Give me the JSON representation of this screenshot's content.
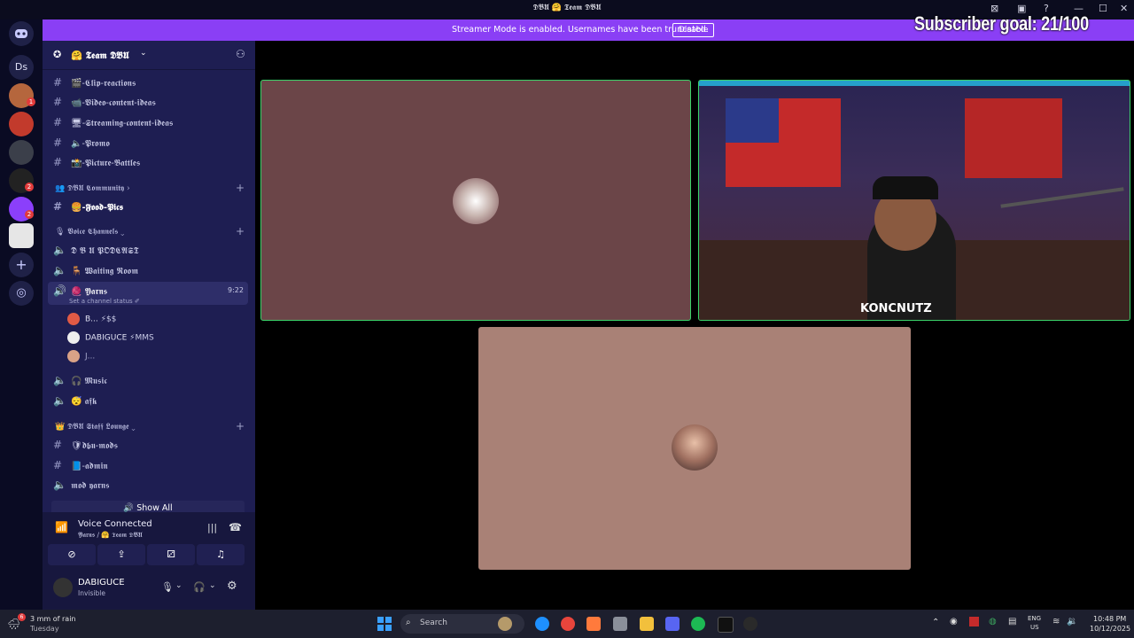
{
  "window": {
    "title": "𝕯𝕭𝖀 🤗 𝕿𝖊𝖆𝖒 𝕯𝕭𝖀",
    "controls": [
      "—",
      "☐",
      "✕"
    ]
  },
  "banner": {
    "message": "Streamer Mode is enabled. Usernames have been truncated.",
    "button": "Disable",
    "color": "#8a3ff5"
  },
  "overlay": {
    "subscriber_goal": "Subscriber goal: 21/100"
  },
  "rail": {
    "ds_label": "Ds",
    "badges": [
      "1",
      "2",
      "2",
      "5"
    ]
  },
  "guild": {
    "name": "🤗 𝕿𝖊𝖆𝖒 𝕯𝕭𝖀"
  },
  "channels": {
    "text_top": [
      {
        "label": "-𝕮𝖑𝖎𝖕-𝖗𝖊𝖆𝖈𝖙𝖎𝖔𝖓𝖘",
        "emoji": "🎬"
      },
      {
        "label": "-𝖁𝖎𝖉𝖊𝖔-𝖈𝖔𝖓𝖙𝖊𝖓𝖙-𝖎𝖉𝖊𝖆𝖘",
        "emoji": "📹"
      },
      {
        "label": "-𝕾𝖙𝖗𝖊𝖆𝖒𝖎𝖓𝖌-𝖈𝖔𝖓𝖙𝖊𝖓𝖙-𝖎𝖉𝖊𝖆𝖘",
        "emoji": "🖥"
      },
      {
        "label": "-𝕻𝖗𝖔𝖒𝖔",
        "emoji": "🔈"
      },
      {
        "label": "-𝕻𝖎𝖈𝖙𝖚𝖗𝖊-𝕭𝖆𝖙𝖙𝖑𝖊𝖘",
        "emoji": "📸"
      }
    ],
    "community_category": "𝕯𝕭𝖀 𝕮𝖔𝖒𝖒𝖚𝖓𝖎𝖙𝖞",
    "food_pics": "-𝕱𝖔𝖔𝖉-𝕻𝖎𝖈𝖘",
    "voice_category": "𝖁𝖔𝖎𝖈𝖊 𝕮𝖍𝖆𝖓𝖓𝖊𝖑𝖘",
    "voice_first": "𝕯 𝕭 𝖀 𝕻𝕺𝕯𝕮𝕬𝕾𝕿",
    "waiting_room": "𝖂𝖆𝖎𝖙𝖎𝖓𝖌 𝕽𝖔𝖔𝖒",
    "active": {
      "label": "𝖄𝖆𝖗𝖓𝖘",
      "time": "9:22",
      "status_hint": "Set a channel status ✐"
    },
    "members": [
      {
        "name": "B...",
        "tag": "⚡$$"
      },
      {
        "name": "DABIGUCE",
        "tag": "⚡MMS"
      },
      {
        "name": "J...",
        "tag": ""
      }
    ],
    "music": "𝕸𝖚𝖘𝖎𝖈",
    "afk": "𝖆𝖋𝖐",
    "staff_category": "𝕯𝕭𝖀 𝕾𝖙𝖆𝖋𝖋 𝕷𝖔𝖚𝖓𝖌𝖊",
    "staff": [
      {
        "label": "𝖉𝖇𝖚-𝖒𝖔𝖉𝖘"
      },
      {
        "label": "-𝖆𝖉𝖒𝖎𝖓"
      },
      {
        "label": "𝖒𝖔𝖉 𝖞𝖆𝖗𝖓𝖘"
      }
    ],
    "show_all": "Show All"
  },
  "voice_panel": {
    "title": "Voice Connected",
    "subtitle": "𝖄𝖆𝖗𝖓𝖘 / 🤗 𝕿𝖊𝖆𝖒 𝕯𝕭𝖀"
  },
  "user": {
    "name": "DABIGUCE",
    "status": "Invisible"
  },
  "streams": {
    "tile2_shirt": "KONCNUTZ"
  },
  "taskbar": {
    "weather_top": "3 mm of rain",
    "weather_bottom": "Tuesday",
    "weather_badge": "6",
    "search": "Search",
    "lang_top": "ENG",
    "lang_bottom": "US",
    "time": "10:48 PM",
    "date": "10/12/2025"
  }
}
